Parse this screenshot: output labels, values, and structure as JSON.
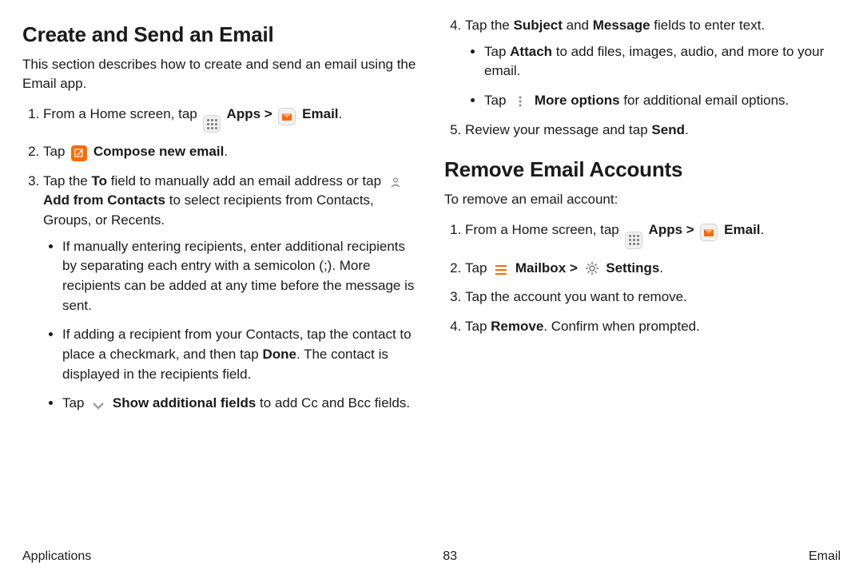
{
  "section1": {
    "heading": "Create and Send an Email",
    "intro": "This section describes how to create and send an email using the Email app.",
    "step1_a": "From a Home screen, tap ",
    "step1_b": " Apps",
    "step1_c": " > ",
    "step1_d": " Email",
    "step1_e": ".",
    "step2_a": "Tap ",
    "step2_b": " Compose new email",
    "step2_c": ".",
    "step3_a": "Tap the ",
    "step3_b": "To",
    "step3_c": " field to manually add an email address or tap ",
    "step3_d": " Add from Contacts",
    "step3_e": " to select recipients from Contacts, Groups, or Recents.",
    "step3_sub1": "If manually entering recipients, enter additional recipients by separating each entry with a semicolon (;). More recipients can be added at any time before the message is sent.",
    "step3_sub2_a": "If adding a recipient from your Contacts, tap the contact to place a checkmark, and then tap ",
    "step3_sub2_b": "Done",
    "step3_sub2_c": ". The contact is displayed in the recipients field.",
    "step3_sub3_a": "Tap ",
    "step3_sub3_b": " Show additional fields",
    "step3_sub3_c": " to add Cc and Bcc fields.",
    "step4_a": "Tap the ",
    "step4_b": "Subject",
    "step4_c": " and ",
    "step4_d": "Message",
    "step4_e": " fields to enter text.",
    "step4_sub1_a": "Tap ",
    "step4_sub1_b": "Attach",
    "step4_sub1_c": " to add files, images, audio, and more to your email.",
    "step4_sub2_a": "Tap ",
    "step4_sub2_b": " More options",
    "step4_sub2_c": " for additional email options.",
    "step5_a": "Review your message and tap ",
    "step5_b": "Send",
    "step5_c": "."
  },
  "section2": {
    "heading": "Remove Email Accounts",
    "intro": "To remove an email account:",
    "step1_a": "From a Home screen, tap ",
    "step1_b": " Apps",
    "step1_c": " > ",
    "step1_d": " Email",
    "step1_e": ".",
    "step2_a": "Tap ",
    "step2_b": " Mailbox",
    "step2_c": " > ",
    "step2_d": " Settings",
    "step2_e": ".",
    "step3": "Tap the account you want to remove.",
    "step4_a": "Tap ",
    "step4_b": "Remove",
    "step4_c": ". Confirm when prompted."
  },
  "footer": {
    "left": "Applications",
    "center": "83",
    "right": "Email"
  }
}
